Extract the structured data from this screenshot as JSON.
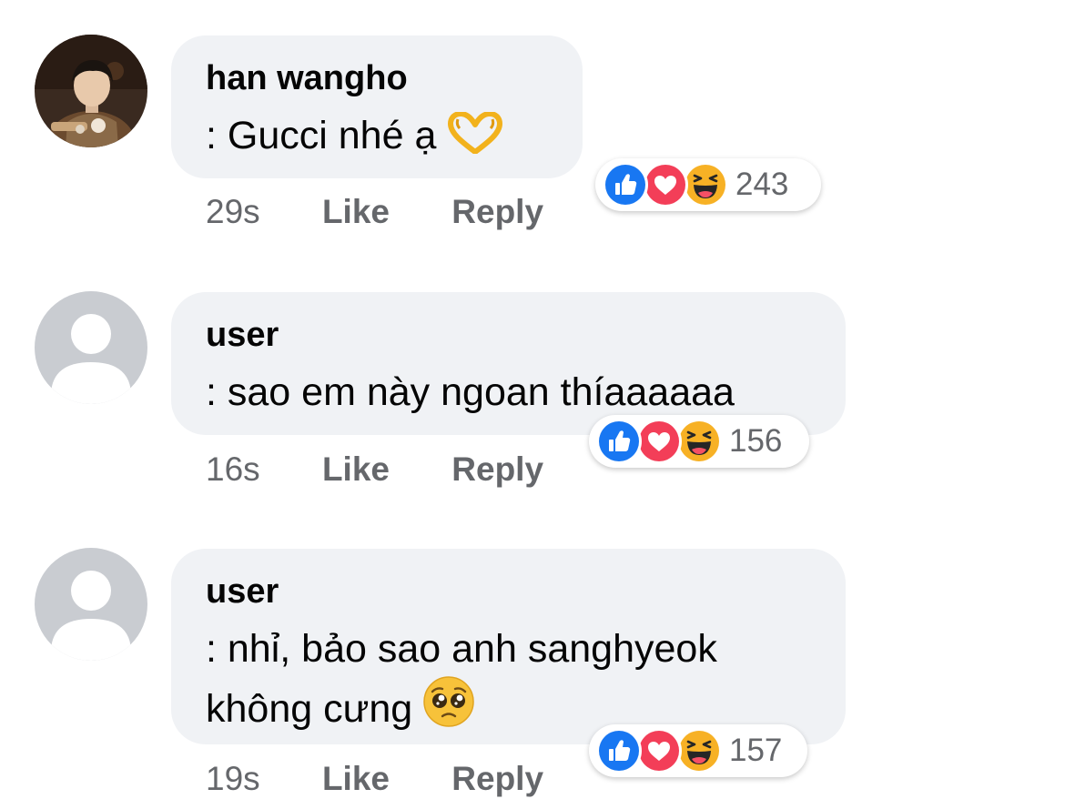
{
  "comments": [
    {
      "author": "han wangho",
      "text_lines": [
        ": Gucci nhé ạ"
      ],
      "emoji": "heart-hands-emoji",
      "time": "29s",
      "like_label": "Like",
      "reply_label": "Reply",
      "reaction_count": "243",
      "reactions": [
        "like-icon",
        "love-icon",
        "haha-icon"
      ],
      "avatar": "profile-photo"
    },
    {
      "author": "user",
      "text_lines": [
        ": sao em này ngoan thíaaaaaa"
      ],
      "time": "16s",
      "like_label": "Like",
      "reply_label": "Reply",
      "reaction_count": "156",
      "reactions": [
        "like-icon",
        "love-icon",
        "haha-icon"
      ],
      "avatar": "default-avatar"
    },
    {
      "author": "user",
      "text_lines": [
        ": nhỉ, bảo sao anh sanghyeok",
        "không cưng"
      ],
      "emoji": "pleading-face-emoji",
      "time": "19s",
      "like_label": "Like",
      "reply_label": "Reply",
      "reaction_count": "157",
      "reactions": [
        "like-icon",
        "love-icon",
        "haha-icon"
      ],
      "avatar": "default-avatar"
    }
  ],
  "colors": {
    "bubble": "#f0f2f5",
    "meta_text": "#65676b",
    "like_blue": "#1877f2",
    "love_red": "#f33e58",
    "haha_yellow": "#f7b125"
  }
}
